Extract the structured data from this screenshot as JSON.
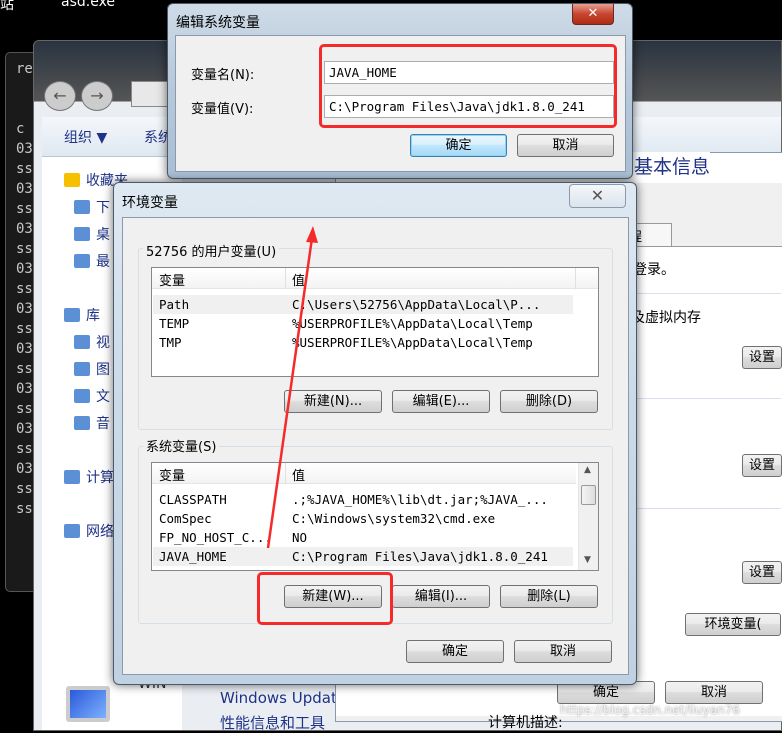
{
  "desktop": {
    "icon1_label": "站",
    "icon2_label": "asd.exe"
  },
  "console": {
    "lines": [
      "re",
      "c",
      "03",
      "ss",
      "03",
      "ss",
      "03",
      "ss",
      "03",
      "ss",
      "03",
      "ss",
      "03",
      "ss",
      "03",
      "ss",
      "03",
      "ss",
      "03",
      "ss",
      "ss"
    ]
  },
  "explorer": {
    "toolbar": {
      "organize": "组织 ▼",
      "system": "系统"
    },
    "sidebar": [
      {
        "label": "收藏夹",
        "icon": "star-icon"
      },
      {
        "label": "下",
        "icon": "downloads-folder-icon"
      },
      {
        "label": "桌",
        "icon": "desktop-icon"
      },
      {
        "label": "最",
        "icon": "recent-places-icon"
      },
      {
        "label": "库",
        "icon": "library-icon"
      },
      {
        "label": "视",
        "icon": "videos-icon"
      },
      {
        "label": "图",
        "icon": "pictures-icon"
      },
      {
        "label": "文",
        "icon": "documents-icon"
      },
      {
        "label": "音",
        "icon": "music-icon"
      },
      {
        "label": "计算",
        "icon": "computer-icon"
      },
      {
        "label": "网络",
        "icon": "network-icon"
      }
    ],
    "bottom": {
      "win_label": "WIN",
      "windows_update": "Windows Updat",
      "perf": "性能信息和工具",
      "computer_desc": "计算机描述:"
    }
  },
  "sysprops": {
    "heading": "基本信息",
    "tab": "程",
    "text1": "登录。",
    "text2": "及虚拟内存",
    "settings1": "设置",
    "settings2": "设置",
    "settings3": "设置",
    "env_button": "环境变量(",
    "ok": "确定",
    "cancel": "取消"
  },
  "edit_dialog": {
    "title": "编辑系统变量",
    "name_label": "变量名(N):",
    "value_label": "变量值(V):",
    "name_value": "JAVA_HOME",
    "value_value": "C:\\Program Files\\Java\\jdk1.8.0_241",
    "ok": "确定",
    "cancel": "取消"
  },
  "env_dialog": {
    "title": "环境变量",
    "user_group": "52756 的用户变量(U)",
    "col_var": "变量",
    "col_val": "值",
    "user_vars": [
      {
        "name": "Path",
        "value": "C:\\Users\\52756\\AppData\\Local\\P..."
      },
      {
        "name": "TEMP",
        "value": "%USERPROFILE%\\AppData\\Local\\Temp"
      },
      {
        "name": "TMP",
        "value": "%USERPROFILE%\\AppData\\Local\\Temp"
      }
    ],
    "user_buttons": {
      "new": "新建(N)...",
      "edit": "编辑(E)...",
      "delete": "删除(D)"
    },
    "system_group": "系统变量(S)",
    "system_vars": [
      {
        "name": "CLASSPATH",
        "value": ".;%JAVA_HOME%\\lib\\dt.jar;%JAVA_..."
      },
      {
        "name": "ComSpec",
        "value": "C:\\Windows\\system32\\cmd.exe"
      },
      {
        "name": "FP_NO_HOST_C...",
        "value": "NO"
      },
      {
        "name": "JAVA_HOME",
        "value": "C:\\Program Files\\Java\\jdk1.8.0_241"
      }
    ],
    "system_buttons": {
      "new": "新建(W)...",
      "edit": "编辑(I)...",
      "delete": "删除(L)"
    },
    "ok": "确定",
    "cancel": "取消"
  },
  "watermark": "https://blog.csdn.net/liuyan76",
  "colors": {
    "highlight": "#f52a2a",
    "link": "#1e3287"
  }
}
